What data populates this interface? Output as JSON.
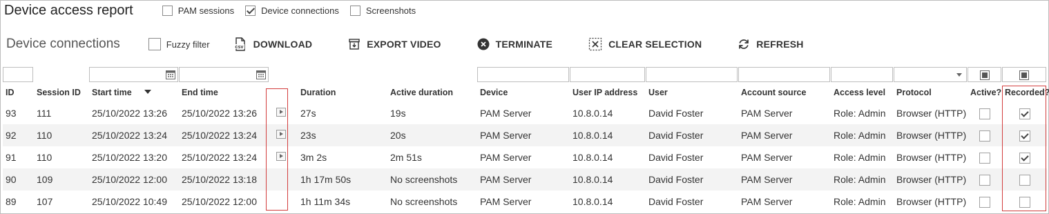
{
  "header": {
    "title": "Device access report",
    "toggles": [
      {
        "label": "PAM sessions",
        "checked": false
      },
      {
        "label": "Device connections",
        "checked": true
      },
      {
        "label": "Screenshots",
        "checked": false
      }
    ]
  },
  "toolbar": {
    "title": "Device connections",
    "fuzzy_filter_label": "Fuzzy filter",
    "download_label": "DOWNLOAD",
    "export_video_label": "EXPORT VIDEO",
    "terminate_label": "TERMINATE",
    "clear_selection_label": "CLEAR SELECTION",
    "refresh_label": "REFRESH",
    "csv_icon_text": "csv"
  },
  "table": {
    "columns": [
      "ID",
      "Session ID",
      "Start time",
      "End time",
      "",
      "Duration",
      "Active duration",
      "Device",
      "User IP address",
      "User",
      "Account source",
      "Access level",
      "Protocol",
      "Active?",
      "Recorded?"
    ],
    "rows": [
      {
        "id": "93",
        "session": "111",
        "start": "25/10/2022 13:26",
        "end": "25/10/2022 13:26",
        "play": true,
        "duration": "27s",
        "active_duration": "19s",
        "device": "PAM Server",
        "ip": "10.8.0.14",
        "user": "David Foster",
        "account_source": "PAM Server",
        "access": "Role: Admin",
        "protocol": "Browser (HTTP)",
        "active": false,
        "recorded": true
      },
      {
        "id": "92",
        "session": "110",
        "start": "25/10/2022 13:24",
        "end": "25/10/2022 13:24",
        "play": true,
        "duration": "23s",
        "active_duration": "20s",
        "device": "PAM Server",
        "ip": "10.8.0.14",
        "user": "David Foster",
        "account_source": "PAM Server",
        "access": "Role: Admin",
        "protocol": "Browser (HTTP)",
        "active": false,
        "recorded": true
      },
      {
        "id": "91",
        "session": "110",
        "start": "25/10/2022 13:20",
        "end": "25/10/2022 13:24",
        "play": true,
        "duration": "3m 2s",
        "active_duration": "2m 51s",
        "device": "PAM Server",
        "ip": "10.8.0.14",
        "user": "David Foster",
        "account_source": "PAM Server",
        "access": "Role: Admin",
        "protocol": "Browser (HTTP)",
        "active": false,
        "recorded": true
      },
      {
        "id": "90",
        "session": "109",
        "start": "25/10/2022 12:00",
        "end": "25/10/2022 13:18",
        "play": false,
        "duration": "1h 17m 50s",
        "active_duration": "No screenshots",
        "device": "PAM Server",
        "ip": "10.8.0.14",
        "user": "David Foster",
        "account_source": "PAM Server",
        "access": "Role: Admin",
        "protocol": "Browser (HTTP)",
        "active": false,
        "recorded": false
      },
      {
        "id": "89",
        "session": "107",
        "start": "25/10/2022 10:49",
        "end": "25/10/2022 12:00",
        "play": false,
        "duration": "1h 11m 34s",
        "active_duration": "No screenshots",
        "device": "PAM Server",
        "ip": "10.8.0.14",
        "user": "David Foster",
        "account_source": "PAM Server",
        "access": "Role: Admin",
        "protocol": "Browser (HTTP)",
        "active": false,
        "recorded": false
      }
    ]
  },
  "colors": {
    "link": "#2a7fd4",
    "highlight": "#d23c3c",
    "row_alt": "#f3f3f3"
  }
}
